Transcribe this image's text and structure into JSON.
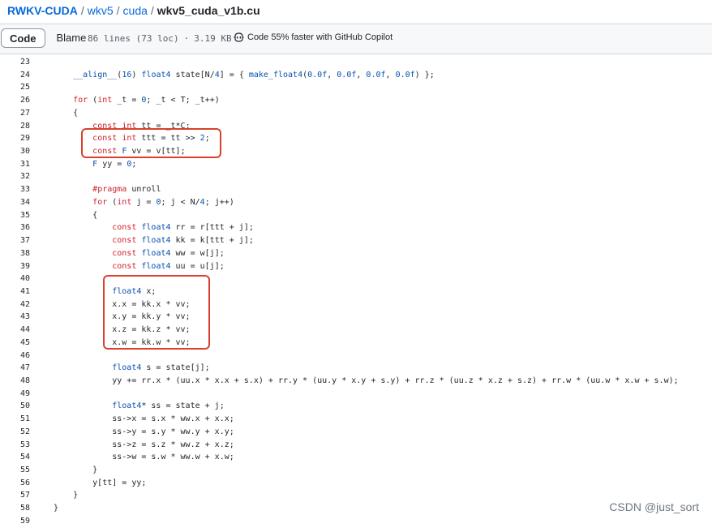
{
  "breadcrumb": {
    "repo": "RWKV-CUDA",
    "parts": [
      "wkv5",
      "cuda"
    ],
    "file": "wkv5_cuda_v1b.cu",
    "sep": "/"
  },
  "toolbar": {
    "code_tab": "Code",
    "blame_tab": "Blame",
    "lines": "86 lines (73 loc)",
    "size": "3.19 KB",
    "dot": "·",
    "copilot": "Code 55% faster with GitHub Copilot",
    "copilot_icon": "copilot-icon"
  },
  "code": {
    "lines": [
      {
        "n": "23",
        "t": ""
      },
      {
        "n": "24",
        "t": "    __align__(16) float4 state[N/4] = { make_float4(0.0f, 0.0f, 0.0f, 0.0f) };"
      },
      {
        "n": "25",
        "t": ""
      },
      {
        "n": "26",
        "t": "    for (int _t = 0; _t < T; _t++)"
      },
      {
        "n": "27",
        "t": "    {"
      },
      {
        "n": "28",
        "t": "        const int tt = _t*C;"
      },
      {
        "n": "29",
        "t": "        const int ttt = tt >> 2;"
      },
      {
        "n": "30",
        "t": "        const F vv = v[tt];"
      },
      {
        "n": "31",
        "t": "        F yy = 0;"
      },
      {
        "n": "32",
        "t": ""
      },
      {
        "n": "33",
        "t": "        #pragma unroll"
      },
      {
        "n": "34",
        "t": "        for (int j = 0; j < N/4; j++)"
      },
      {
        "n": "35",
        "t": "        {"
      },
      {
        "n": "36",
        "t": "            const float4 rr = r[ttt + j];"
      },
      {
        "n": "37",
        "t": "            const float4 kk = k[ttt + j];"
      },
      {
        "n": "38",
        "t": "            const float4 ww = w[j];"
      },
      {
        "n": "39",
        "t": "            const float4 uu = u[j];"
      },
      {
        "n": "40",
        "t": ""
      },
      {
        "n": "41",
        "t": "            float4 x;"
      },
      {
        "n": "42",
        "t": "            x.x = kk.x * vv;"
      },
      {
        "n": "43",
        "t": "            x.y = kk.y * vv;"
      },
      {
        "n": "44",
        "t": "            x.z = kk.z * vv;"
      },
      {
        "n": "45",
        "t": "            x.w = kk.w * vv;"
      },
      {
        "n": "46",
        "t": ""
      },
      {
        "n": "47",
        "t": "            float4 s = state[j];"
      },
      {
        "n": "48",
        "t": "            yy += rr.x * (uu.x * x.x + s.x) + rr.y * (uu.y * x.y + s.y) + rr.z * (uu.z * x.z + s.z) + rr.w * (uu.w * x.w + s.w);"
      },
      {
        "n": "49",
        "t": ""
      },
      {
        "n": "50",
        "t": "            float4* ss = state + j;"
      },
      {
        "n": "51",
        "t": "            ss->x = s.x * ww.x + x.x;"
      },
      {
        "n": "52",
        "t": "            ss->y = s.y * ww.y + x.y;"
      },
      {
        "n": "53",
        "t": "            ss->z = s.z * ww.z + x.z;"
      },
      {
        "n": "54",
        "t": "            ss->w = s.w * ww.w + x.w;"
      },
      {
        "n": "55",
        "t": "        }"
      },
      {
        "n": "56",
        "t": "        y[tt] = yy;"
      },
      {
        "n": "57",
        "t": "    }"
      },
      {
        "n": "58",
        "t": "}"
      },
      {
        "n": "59",
        "t": ""
      }
    ]
  },
  "annotation_color": "#d9412d",
  "watermark": "CSDN @just_sort"
}
